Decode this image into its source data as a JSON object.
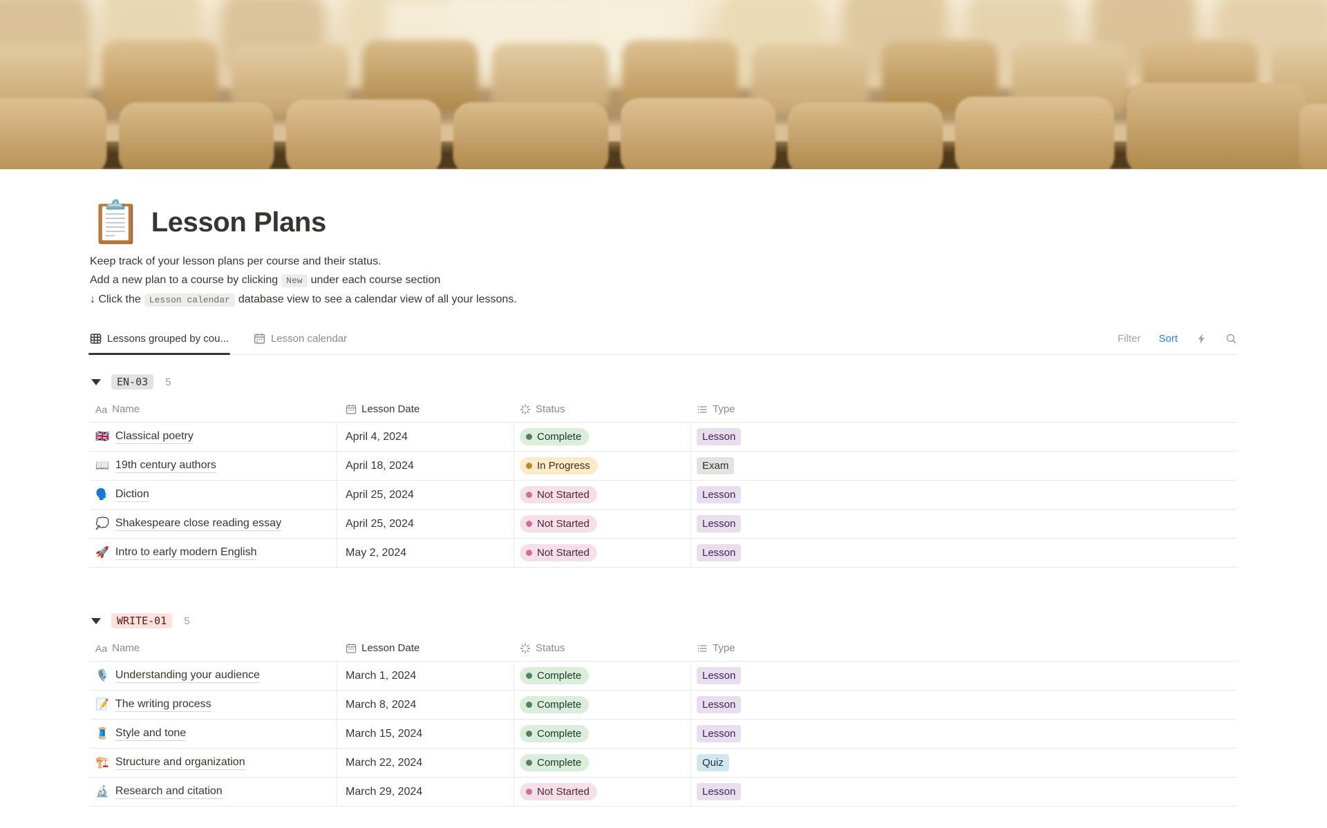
{
  "page": {
    "icon": "📋",
    "title": "Lesson Plans",
    "description": [
      {
        "text": "Keep track of your lesson plans per course and their status."
      },
      {
        "before": "Add a new plan to a course by clicking",
        "code": "New",
        "after": "under each course section"
      },
      {
        "before": "↓ Click the",
        "code": "Lesson calendar",
        "after": "database view to see a calendar view of all your lessons."
      }
    ]
  },
  "toolbar": {
    "tabs": [
      {
        "label": "Lessons grouped by cou...",
        "active": true
      },
      {
        "label": "Lesson calendar",
        "active": false
      }
    ],
    "filter": "Filter",
    "sort": "Sort",
    "accent": "#2383E2"
  },
  "columns": {
    "name_icon": "Aa",
    "name": "Name",
    "date": "Lesson Date",
    "status": "Status",
    "type": "Type"
  },
  "groups": [
    {
      "name": "EN-03",
      "count": "5",
      "tag_bg": "#E3E2E0",
      "tag_text": "#37352F",
      "rows": [
        {
          "emoji": "🇬🇧",
          "name": "Classical poetry",
          "date": "April 4, 2024",
          "status": "Complete",
          "type": "Lesson"
        },
        {
          "emoji": "📖",
          "name": "19th century authors",
          "date": "April 18, 2024",
          "status": "In Progress",
          "type": "Exam"
        },
        {
          "emoji": "🗣️",
          "name": "Diction",
          "date": "April 25, 2024",
          "status": "Not Started",
          "type": "Lesson"
        },
        {
          "emoji": "💭",
          "name": "Shakespeare close reading essay",
          "date": "April 25, 2024",
          "status": "Not Started",
          "type": "Lesson"
        },
        {
          "emoji": "🚀",
          "name": "Intro to early modern English",
          "date": "May 2, 2024",
          "status": "Not Started",
          "type": "Lesson"
        }
      ]
    },
    {
      "name": "WRITE-01",
      "count": "5",
      "tag_bg": "#FFE2DD",
      "tag_text": "#5D1715",
      "rows": [
        {
          "emoji": "🎙️",
          "name": "Understanding your audience",
          "date": "March 1, 2024",
          "status": "Complete",
          "type": "Lesson"
        },
        {
          "emoji": "📝",
          "name": "The writing process",
          "date": "March 8, 2024",
          "status": "Complete",
          "type": "Lesson"
        },
        {
          "emoji": "🧵",
          "name": "Style and tone",
          "date": "March 15, 2024",
          "status": "Complete",
          "type": "Lesson"
        },
        {
          "emoji": "🏗️",
          "name": "Structure and organization",
          "date": "March 22, 2024",
          "status": "Complete",
          "type": "Quiz"
        },
        {
          "emoji": "🔬",
          "name": "Research and citation",
          "date": "March 29, 2024",
          "status": "Not Started",
          "type": "Lesson"
        }
      ]
    }
  ],
  "badges": {
    "status": {
      "Complete": {
        "bg": "#DBEDDB",
        "dot": "#548164",
        "text": "#1C3829"
      },
      "In Progress": {
        "bg": "#FAEBC9",
        "dot": "#BB8A2D",
        "text": "#402C1B"
      },
      "Not Started": {
        "bg": "#F6E0E7",
        "dot": "#CF6D9E",
        "text": "#4C2337"
      }
    },
    "type": {
      "Lesson": {
        "bg": "#E8DEEE",
        "text": "#412454"
      },
      "Exam": {
        "bg": "#E3E2E0",
        "text": "#32302C"
      },
      "Quiz": {
        "bg": "#D3E5EF",
        "text": "#183347"
      }
    }
  }
}
